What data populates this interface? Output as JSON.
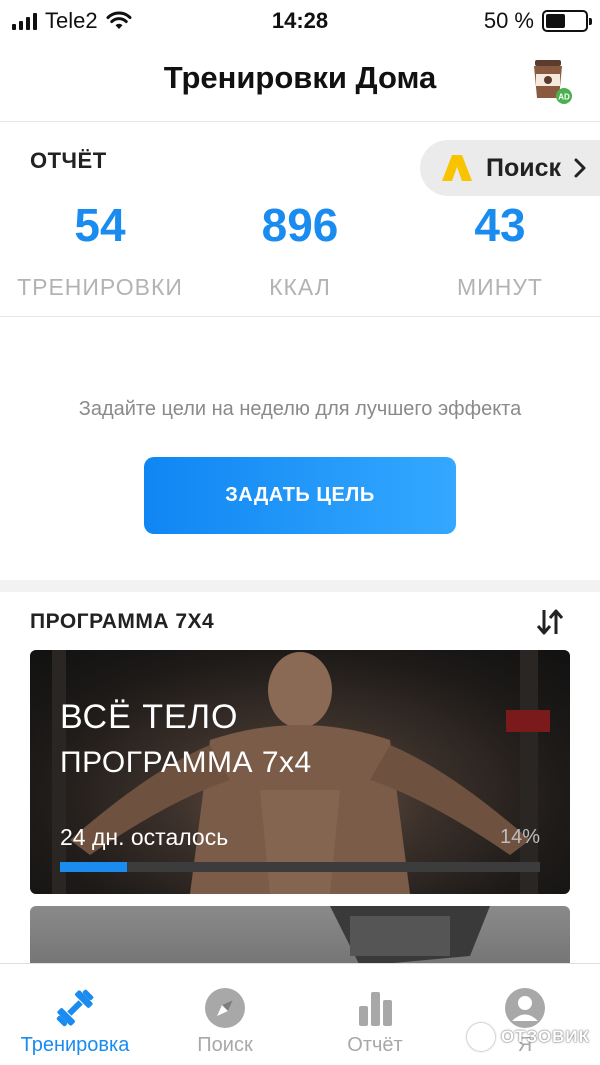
{
  "status_bar": {
    "carrier": "Tele2",
    "time": "14:28",
    "battery_text": "50 %",
    "battery_level": 0.5
  },
  "header": {
    "title": "Тренировки Дома",
    "ad_badge": "AD"
  },
  "report": {
    "title": "ОТЧЁТ",
    "search_label": "Поиск",
    "stats": [
      {
        "value": "54",
        "label": "ТРЕНИРОВКИ"
      },
      {
        "value": "896",
        "label": "ККАЛ"
      },
      {
        "value": "43",
        "label": "МИНУТ"
      }
    ]
  },
  "goal": {
    "text": "Задайте цели на неделю для лучшего эффекта",
    "button_label": "ЗАДАТЬ ЦЕЛЬ"
  },
  "program": {
    "section_title": "ПРОГРАММА 7Х4",
    "card": {
      "line1": "ВСЁ ТЕЛО",
      "line2": "ПРОГРАММА 7x4",
      "remaining": "24 дн. осталось",
      "percent": "14%",
      "progress": 0.14
    }
  },
  "tabs": [
    {
      "label": "Тренировка",
      "icon": "dumbbell-icon",
      "active": true
    },
    {
      "label": "Поиск",
      "icon": "compass-icon",
      "active": false
    },
    {
      "label": "Отчёт",
      "icon": "bar-chart-icon",
      "active": false
    },
    {
      "label": "Я",
      "icon": "profile-icon",
      "active": false
    }
  ],
  "watermark": {
    "text": "ОТЗОВИК"
  },
  "colors": {
    "accent": "#1a8cf0",
    "muted": "#b3b3b3"
  }
}
